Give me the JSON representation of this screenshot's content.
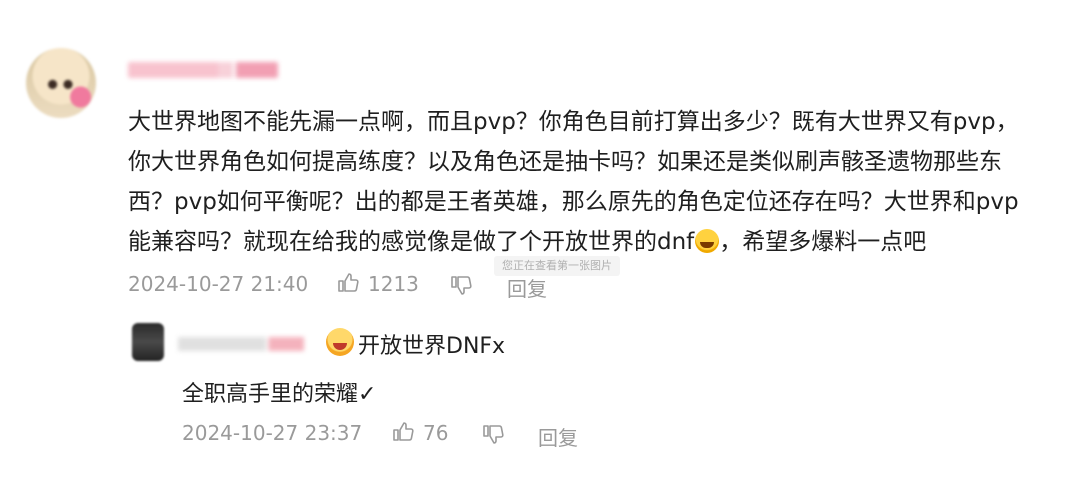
{
  "comment": {
    "lines": [
      "大世界地图不能先漏一点啊，而且pvp？你角色目前打算出多少？既有大世界又有pvp，",
      "你大世界角色如何提高练度？以及角色还是抽卡吗？如果还是类似刷声骸圣遗物那些东",
      "西？pvp如何平衡呢？出的都是王者英雄，那么原先的角色定位还存在吗？大世界和pvp",
      "能兼容吗？就现在给我的感觉像是做了个开放世界的dnf",
      "，希望多爆料一点吧"
    ],
    "emoji_icon": "laughing-crying-emoji",
    "timestamp": "2024-10-27 21:40",
    "like_count": "1213",
    "reply_label": "回复"
  },
  "tooltip": "您正在查看第一张图片",
  "reply": {
    "badge_icon": "screaming-face-emoji",
    "badge_text": "开放世界DNFx",
    "text": "全职高手里的荣耀✓",
    "timestamp": "2024-10-27 23:37",
    "like_count": "76",
    "reply_label": "回复"
  },
  "colors": {
    "meta_gray": "#9a9a9a",
    "text": "#1f1f1f"
  }
}
